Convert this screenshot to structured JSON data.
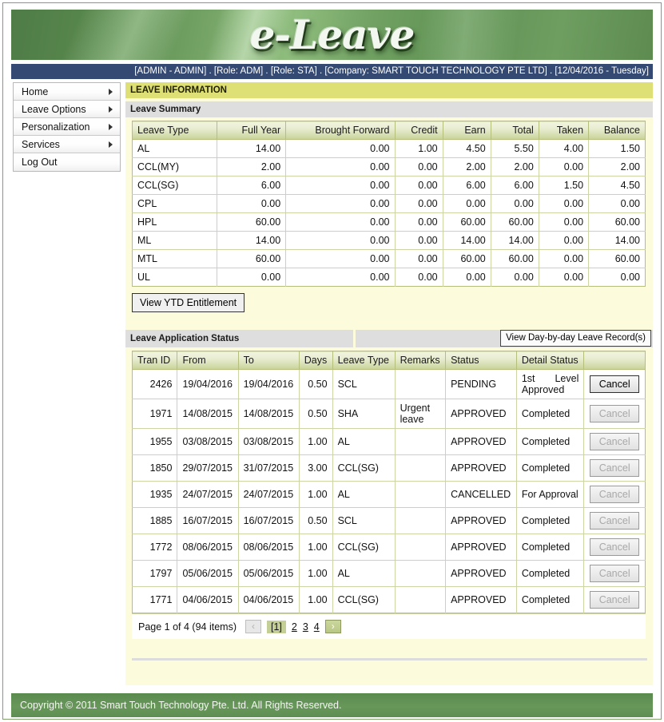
{
  "app": {
    "logo_text": "e-Leave",
    "infobar": "[ADMIN - ADMIN] . [Role: ADM] . [Role: STA] . [Company: SMART TOUCH TECHNOLOGY PTE LTD] . [12/04/2016 - Tuesday]",
    "footer": "Copyright © 2011 Smart Touch Technology Pte. Ltd.  All Rights Reserved.",
    "accent_green": "#5a8a4e",
    "accent_yellow": "#dedf74",
    "panel_bg": "#fcfcdd",
    "infobar_bg": "#354a72"
  },
  "sidebar": {
    "items": [
      {
        "label": "Home",
        "has_arrow": true
      },
      {
        "label": "Leave Options",
        "has_arrow": true
      },
      {
        "label": "Personalization",
        "has_arrow": true
      },
      {
        "label": "Services",
        "has_arrow": true
      },
      {
        "label": "Log Out",
        "has_arrow": false
      }
    ]
  },
  "main": {
    "page_title": "LEAVE INFORMATION",
    "summary": {
      "heading": "Leave Summary",
      "columns": [
        "Leave Type",
        "Full Year",
        "Brought Forward",
        "Credit",
        "Earn",
        "Total",
        "Taken",
        "Balance"
      ],
      "rows": [
        [
          "AL",
          "14.00",
          "0.00",
          "1.00",
          "4.50",
          "5.50",
          "4.00",
          "1.50"
        ],
        [
          "CCL(MY)",
          "2.00",
          "0.00",
          "0.00",
          "2.00",
          "2.00",
          "0.00",
          "2.00"
        ],
        [
          "CCL(SG)",
          "6.00",
          "0.00",
          "0.00",
          "6.00",
          "6.00",
          "1.50",
          "4.50"
        ],
        [
          "CPL",
          "0.00",
          "0.00",
          "0.00",
          "0.00",
          "0.00",
          "0.00",
          "0.00"
        ],
        [
          "HPL",
          "60.00",
          "0.00",
          "0.00",
          "60.00",
          "60.00",
          "0.00",
          "60.00"
        ],
        [
          "ML",
          "14.00",
          "0.00",
          "0.00",
          "14.00",
          "14.00",
          "0.00",
          "14.00"
        ],
        [
          "MTL",
          "60.00",
          "0.00",
          "0.00",
          "60.00",
          "60.00",
          "0.00",
          "60.00"
        ],
        [
          "UL",
          "0.00",
          "0.00",
          "0.00",
          "0.00",
          "0.00",
          "0.00",
          "0.00"
        ]
      ],
      "ytd_button": "View YTD Entitlement"
    },
    "status": {
      "heading": "Leave Application Status",
      "dayrec_button": "View Day-by-day Leave Record(s)",
      "columns": [
        "Tran ID",
        "From",
        "To",
        "Days",
        "Leave Type",
        "Remarks",
        "Status",
        "Detail Status",
        ""
      ],
      "rows": [
        {
          "tran_id": "2426",
          "from": "19/04/2016",
          "to": "19/04/2016",
          "days": "0.50",
          "leave_type": "SCL",
          "remarks": "",
          "status": "PENDING",
          "detail_status": "1st Level Approved",
          "detail_justify": true,
          "action": "Cancel",
          "action_enabled": true
        },
        {
          "tran_id": "1971",
          "from": "14/08/2015",
          "to": "14/08/2015",
          "days": "0.50",
          "leave_type": "SHA",
          "remarks": "Urgent leave",
          "status": "APPROVED",
          "detail_status": "Completed",
          "detail_justify": false,
          "action": "Cancel",
          "action_enabled": false
        },
        {
          "tran_id": "1955",
          "from": "03/08/2015",
          "to": "03/08/2015",
          "days": "1.00",
          "leave_type": "AL",
          "remarks": "",
          "status": "APPROVED",
          "detail_status": "Completed",
          "detail_justify": false,
          "action": "Cancel",
          "action_enabled": false
        },
        {
          "tran_id": "1850",
          "from": "29/07/2015",
          "to": "31/07/2015",
          "days": "3.00",
          "leave_type": "CCL(SG)",
          "remarks": "",
          "status": "APPROVED",
          "detail_status": "Completed",
          "detail_justify": false,
          "action": "Cancel",
          "action_enabled": false
        },
        {
          "tran_id": "1935",
          "from": "24/07/2015",
          "to": "24/07/2015",
          "days": "1.00",
          "leave_type": "AL",
          "remarks": "",
          "status": "CANCELLED",
          "detail_status": "For Approval",
          "detail_justify": false,
          "action": "Cancel",
          "action_enabled": false
        },
        {
          "tran_id": "1885",
          "from": "16/07/2015",
          "to": "16/07/2015",
          "days": "0.50",
          "leave_type": "SCL",
          "remarks": "",
          "status": "APPROVED",
          "detail_status": "Completed",
          "detail_justify": false,
          "action": "Cancel",
          "action_enabled": false
        },
        {
          "tran_id": "1772",
          "from": "08/06/2015",
          "to": "08/06/2015",
          "days": "1.00",
          "leave_type": "CCL(SG)",
          "remarks": "",
          "status": "APPROVED",
          "detail_status": "Completed",
          "detail_justify": false,
          "action": "Cancel",
          "action_enabled": false
        },
        {
          "tran_id": "1797",
          "from": "05/06/2015",
          "to": "05/06/2015",
          "days": "1.00",
          "leave_type": "AL",
          "remarks": "",
          "status": "APPROVED",
          "detail_status": "Completed",
          "detail_justify": false,
          "action": "Cancel",
          "action_enabled": false
        },
        {
          "tran_id": "1771",
          "from": "04/06/2015",
          "to": "04/06/2015",
          "days": "1.00",
          "leave_type": "CCL(SG)",
          "remarks": "",
          "status": "APPROVED",
          "detail_status": "Completed",
          "detail_justify": false,
          "action": "Cancel",
          "action_enabled": false
        }
      ],
      "pagination": {
        "summary_text": "Page 1 of 4 (94 items)",
        "prev_icon": "‹",
        "next_icon": "›",
        "current": "[1]",
        "links": [
          "2",
          "3",
          "4"
        ]
      }
    }
  }
}
